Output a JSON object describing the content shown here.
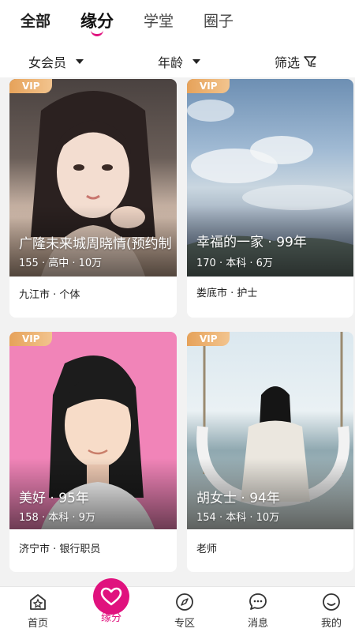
{
  "top_tabs": [
    "全部",
    "缘分",
    "学堂",
    "圈子"
  ],
  "filters": {
    "member": "女会员",
    "age": "年龄",
    "screen": "筛选"
  },
  "cards": [
    {
      "vip": "VIP",
      "name": "广隆未来城周晓情(预约制",
      "meta": "155 · 高中 · 10万",
      "location": "九江市 · 个体"
    },
    {
      "vip": "VIP",
      "name": "幸福的一家 · 99年",
      "meta": "170 · 本科 · 6万",
      "location": "娄底市 · 护士"
    },
    {
      "vip": "VIP",
      "name": "美好 · 95年",
      "meta": "158 · 本科 · 9万",
      "location": "济宁市 · 银行职员"
    },
    {
      "vip": "VIP",
      "name": "胡女士 · 94年",
      "meta": "154 · 本科 · 10万",
      "location": "老师"
    }
  ],
  "bottom_nav": [
    "首页",
    "缘分",
    "专区",
    "消息",
    "我的"
  ],
  "colors": {
    "accent": "#e0127e",
    "vip": "#e6a25a"
  }
}
